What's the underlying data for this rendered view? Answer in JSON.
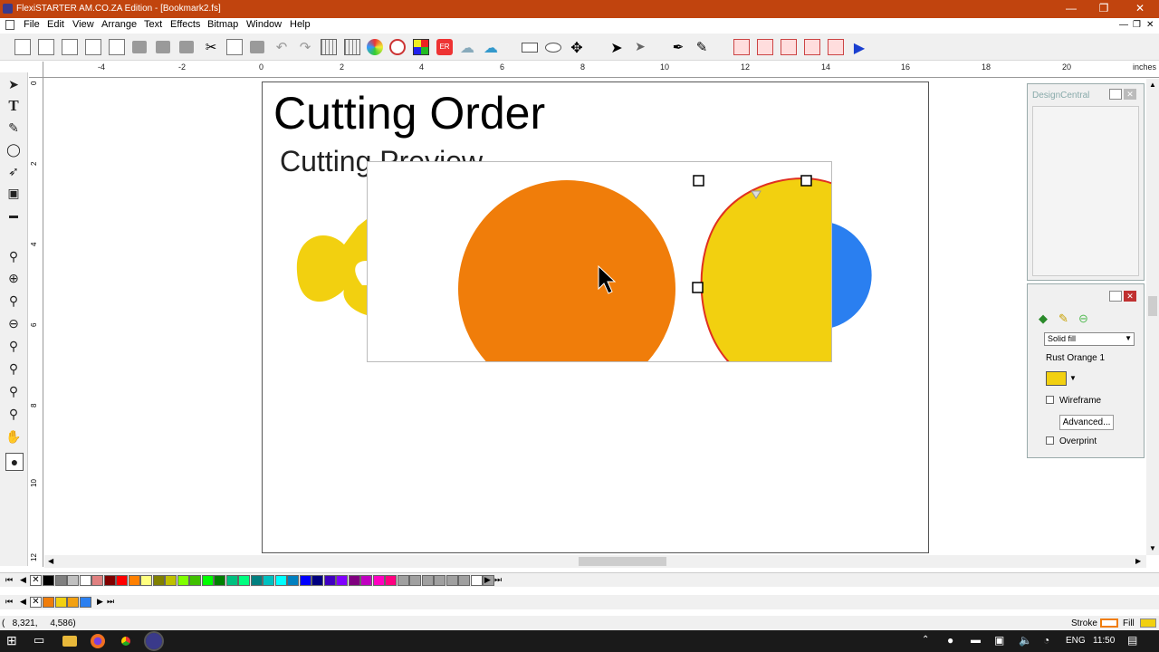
{
  "window": {
    "title": "FlexiSTARTER AM.CO.ZA Edition - [Bookmark2.fs]",
    "minimize": "—",
    "maximize": "❐",
    "close": "✕"
  },
  "menu": [
    "File",
    "Edit",
    "View",
    "Arrange",
    "Text",
    "Effects",
    "Bitmap",
    "Window",
    "Help"
  ],
  "ruler": {
    "unit": "inches",
    "h_labels": [
      "-4",
      "-2",
      "0",
      "2",
      "4",
      "6",
      "8",
      "10",
      "12",
      "14",
      "16",
      "18",
      "20"
    ],
    "v_labels": [
      "0",
      "2",
      "4",
      "6",
      "8",
      "10",
      "12"
    ]
  },
  "document": {
    "title": "Cutting Order",
    "subtitle": "Cutting Preview"
  },
  "colors": {
    "orange": "#f07d0a",
    "yellow": "#f2d010",
    "blue": "#2a7ff0",
    "accent": "#c1440e"
  },
  "designcentral": {
    "title": "DesignCentral"
  },
  "fillpanel": {
    "fill_type": "Solid fill",
    "color_name": "Rust Orange 1",
    "wireframe_label": "Wireframe",
    "advanced_label": "Advanced...",
    "overprint_label": "Overprint"
  },
  "palette": {
    "row1": [
      "#000000",
      "#808080",
      "#c0c0c0",
      "#ffffff",
      "#e08080",
      "#800000",
      "#ff0000",
      "#ff8000",
      "#ffff80",
      "#808000",
      "#c0c000",
      "#80ff00",
      "#40c000",
      "#00ff00",
      "#008000",
      "#00c080",
      "#00ff80",
      "#008080",
      "#00c0c0",
      "#00ffff",
      "#0080c0",
      "#0000ff",
      "#000080",
      "#4000c0",
      "#8000ff",
      "#800080",
      "#c000c0",
      "#ff00c0",
      "#ff0080",
      "#a0a0a0",
      "#a0a0a0",
      "#a0a0a0",
      "#a0a0a0",
      "#a0a0a0",
      "#a0a0a0",
      "#ffffff",
      "#a0a0a0"
    ],
    "row2": [
      "#f07d0a",
      "#f2d010",
      "#f2a010",
      "#2a7ff0"
    ]
  },
  "status": {
    "coords": "(   8,321,     4,586)",
    "stroke_label": "Stroke",
    "fill_label": "Fill"
  },
  "tray": {
    "lang": "ENG",
    "time": "11:50"
  }
}
